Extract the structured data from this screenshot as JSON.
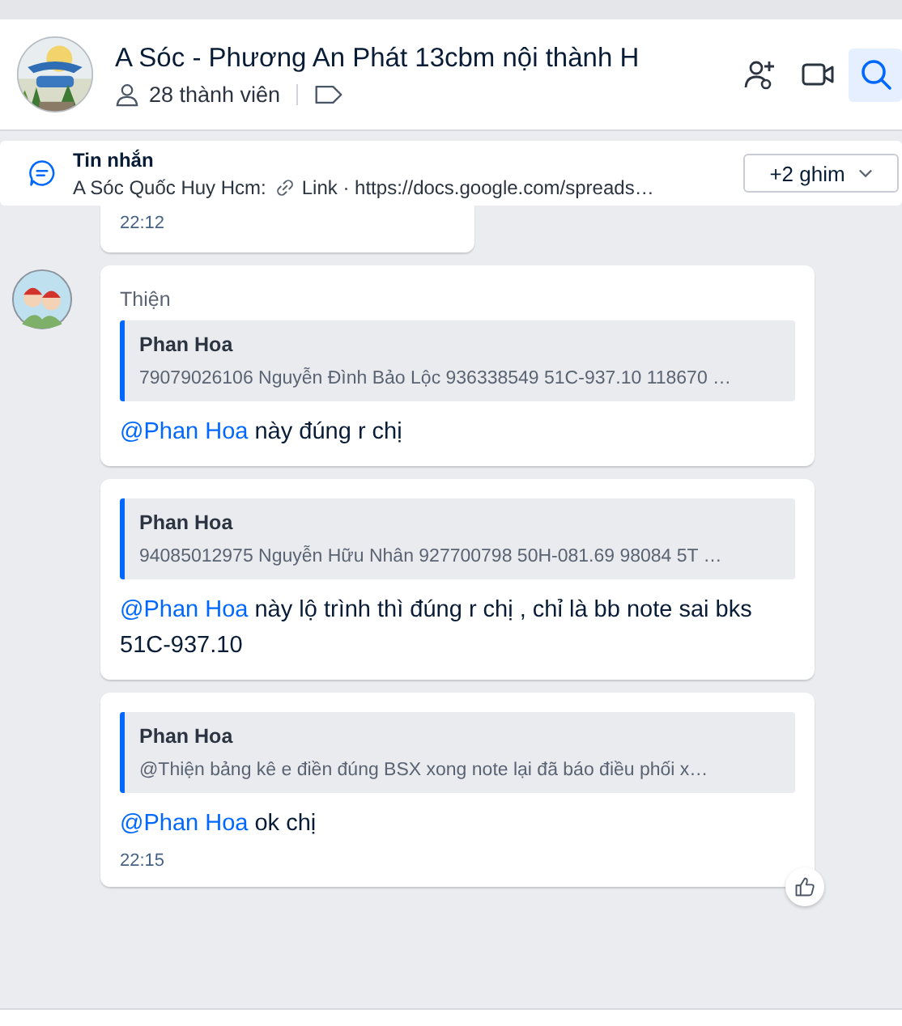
{
  "header": {
    "title": "A Sóc - Phương An Phát 13cbm nội thành H",
    "members": "28 thành viên",
    "actions": [
      {
        "kind": "add-member",
        "selected": false
      },
      {
        "kind": "video",
        "selected": false
      },
      {
        "kind": "search",
        "selected": true
      }
    ]
  },
  "pinned": {
    "label": "Tin nhắn",
    "sender": "A Sóc Quốc Huy Hcm:",
    "link": "Link · https://docs.google.com/spreads…",
    "button": "+2 ghim"
  },
  "previous": {
    "time": "22:12"
  },
  "group": {
    "sender": "Thiện",
    "messages": [
      {
        "quote": {
          "name": "Phan Hoa",
          "text": "79079026106 Nguyễn Đình Bảo Lộc 936338549 51C-937.10 118670 …"
        },
        "mention": "@Phan Hoa",
        "text": " này đúng r chị"
      },
      {
        "quote": {
          "name": "Phan Hoa",
          "text": "94085012975 Nguyễn Hữu Nhân 927700798 50H-081.69 98084 5T …"
        },
        "mention": "@Phan Hoa",
        "text": " này lộ trình thì đúng r chị , chỉ là bb note sai bks 51C-937.10"
      },
      {
        "quote": {
          "name": "Phan Hoa",
          "text": "@Thiện bảng kê e điền đúng BSX xong note lại đã báo điều phối x…"
        },
        "mention": "@Phan Hoa",
        "text": " ok chị",
        "time": "22:15",
        "reaction": true
      }
    ]
  }
}
